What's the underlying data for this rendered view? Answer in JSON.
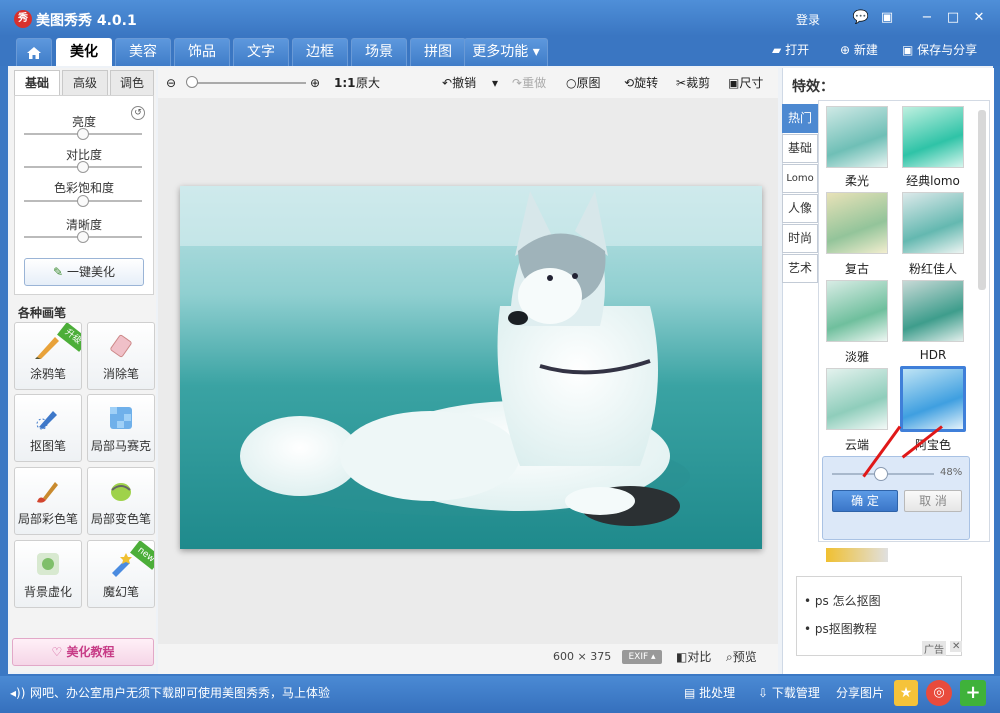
{
  "app": {
    "logo_text": "秀",
    "title": "美图秀秀 4.0.1",
    "login": "登录"
  },
  "window_controls": [
    "💬",
    "▣",
    "−",
    "□",
    "✕"
  ],
  "tabs": [
    "美化",
    "美容",
    "饰品",
    "文字",
    "边框",
    "场景",
    "拼图",
    "更多功能 ▾"
  ],
  "top_actions": {
    "open": "打开",
    "new": "新建",
    "save_share": "保存与分享"
  },
  "left": {
    "subtabs": [
      "基础",
      "高级",
      "调色"
    ],
    "sliders": [
      {
        "label": "亮度",
        "value": 0.5
      },
      {
        "label": "对比度",
        "value": 0.5
      },
      {
        "label": "色彩饱和度",
        "value": 0.5
      },
      {
        "label": "清晰度",
        "value": 0.5
      }
    ],
    "one_click": "一键美化",
    "brushes_title": "各种画笔",
    "brushes": [
      {
        "label": "涂鸦笔",
        "badge": "升级"
      },
      {
        "label": "消除笔",
        "badge": ""
      },
      {
        "label": "抠图笔",
        "badge": ""
      },
      {
        "label": "局部马赛克",
        "badge": ""
      },
      {
        "label": "局部彩色笔",
        "badge": ""
      },
      {
        "label": "局部变色笔",
        "badge": ""
      },
      {
        "label": "背景虚化",
        "badge": ""
      },
      {
        "label": "魔幻笔",
        "badge": "new"
      }
    ],
    "tutorial": "美化教程"
  },
  "toolbar": {
    "zoom_ratio": "1:1",
    "original_size": "原大",
    "undo": "撤销",
    "redo": "重做",
    "original": "原图",
    "rotate": "旋转",
    "crop": "裁剪",
    "size": "尺寸"
  },
  "status": {
    "width": "600",
    "x": "×",
    "height": "375",
    "exif": "EXIF ▴",
    "compare": "对比",
    "preview": "预览"
  },
  "right": {
    "title": "特效：",
    "vtabs": [
      "热门",
      "基础",
      "Lomo",
      "人像",
      "时尚",
      "艺术"
    ],
    "effects": [
      "柔光",
      "经典lomo",
      "复古",
      "粉红佳人",
      "淡雅",
      "HDR",
      "云端",
      "阿宝色"
    ],
    "selected_effect": "阿宝色",
    "opacity": "48%",
    "opacity_value": 0.48,
    "confirm": "确 定",
    "cancel": "取 消",
    "links": [
      "ps 怎么抠图",
      "ps抠图教程"
    ],
    "ad_tag": "广告",
    "ad_close": "✕"
  },
  "bottom": {
    "notice": "网吧、办公室用户无须下载即可使用美图秀秀，马上体验",
    "batch": "批处理",
    "download": "下载管理",
    "share": "分享图片"
  },
  "colors": {
    "accent": "#3a76c2",
    "red_arrow": "#e01818",
    "selected_border": "#3f7fd9"
  }
}
